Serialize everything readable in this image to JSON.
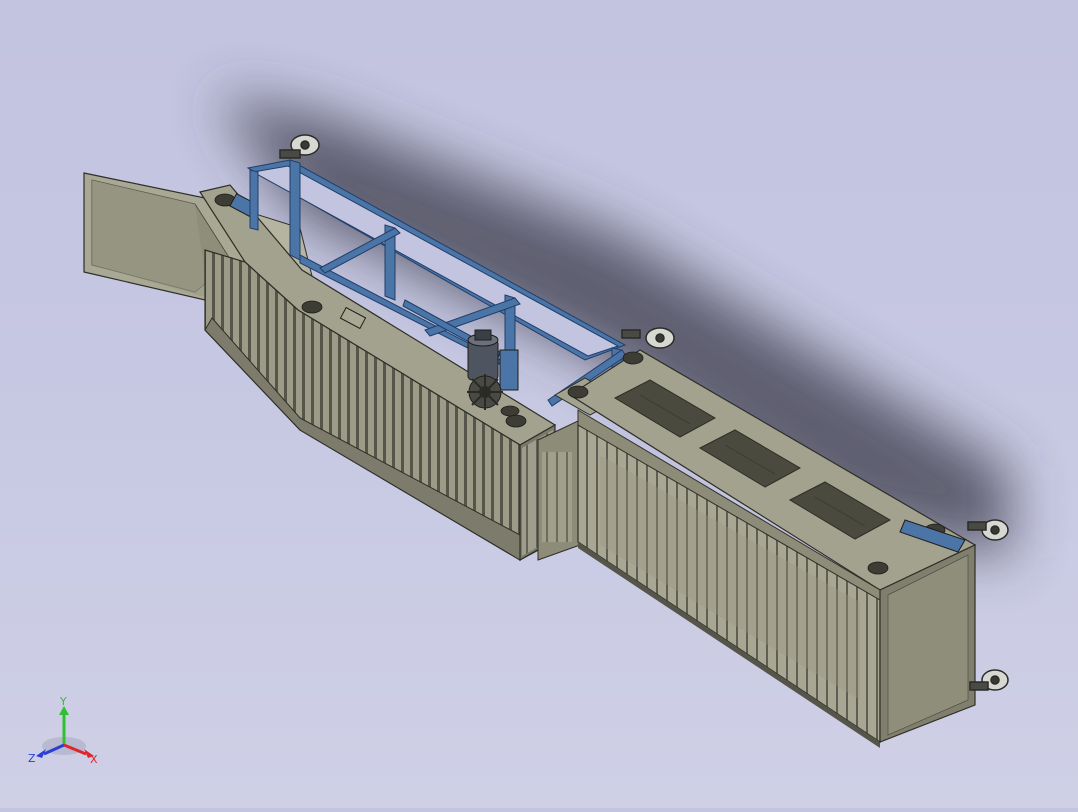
{
  "viewport": {
    "background_top": "#c3c4e0",
    "background_bottom": "#cfd0e6",
    "model_colors": {
      "body": "#8d8c78",
      "body_light": "#a7a692",
      "body_dark": "#6d6c5c",
      "frame": "#4b74a7",
      "edge": "#2e2e28"
    }
  },
  "triad": {
    "x_label": "X",
    "y_label": "Y",
    "z_label": "Z",
    "x_color": "#e0262a",
    "y_color": "#2fbf2f",
    "z_color": "#2b3fd6"
  }
}
